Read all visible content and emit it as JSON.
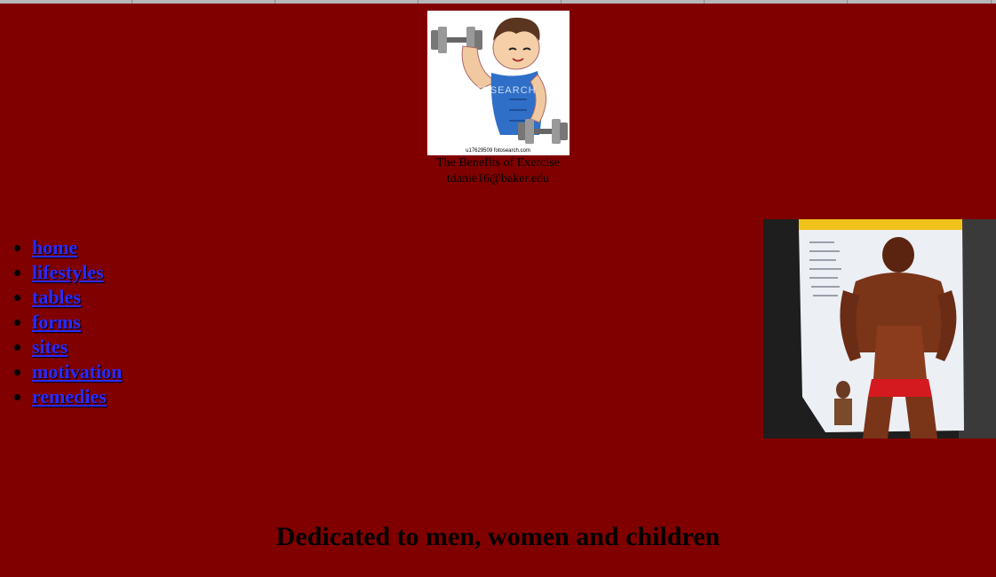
{
  "header": {
    "logo_caption": "u17629509 fotosearch.com",
    "logo_watermark": "FOTOSEARCH",
    "title": "The Benefits of Exercise",
    "email": "tdanie16@baker.edu"
  },
  "nav": {
    "items": [
      {
        "label": "home"
      },
      {
        "label": "lifestyles"
      },
      {
        "label": "tables"
      },
      {
        "label": "forms"
      },
      {
        "label": "sites"
      },
      {
        "label": "motivation"
      },
      {
        "label": "remedies"
      }
    ]
  },
  "tagline": "Dedicated to men, women and children",
  "colors": {
    "background": "#800000",
    "link": "#2a2aff",
    "text": "#000000"
  }
}
